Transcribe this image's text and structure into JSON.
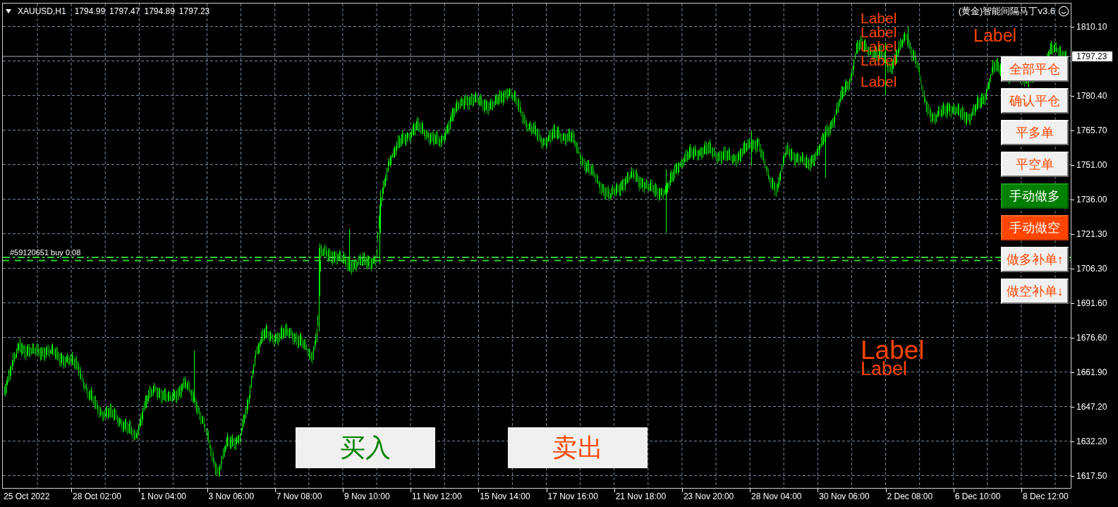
{
  "chart_header": {
    "symbol": "XAUUSD,H1",
    "ohlc": [
      "1794.99",
      "1797.47",
      "1794.89",
      "1797.23"
    ]
  },
  "expert_title": "(黄金)智能间隔马丁v3.6",
  "text_labels": [
    "Label",
    "Label",
    "Label",
    "Label",
    "Label",
    "Label",
    "Label",
    "Label"
  ],
  "order_labels": [
    "#59120651 buy 0.08"
  ],
  "panel_buttons": [
    {
      "label": "全部平仓",
      "kind": "plain"
    },
    {
      "label": "确认平仓",
      "kind": "plain"
    },
    {
      "label": "平多单",
      "kind": "plain"
    },
    {
      "label": "平空单",
      "kind": "plain"
    },
    {
      "label": "手动做多",
      "kind": "buy"
    },
    {
      "label": "手动做空",
      "kind": "sell"
    },
    {
      "label": "做多补单↑",
      "kind": "plain"
    },
    {
      "label": "做空补单↓",
      "kind": "plain"
    }
  ],
  "trade_buttons": [
    {
      "label": "买入",
      "kind": "buy"
    },
    {
      "label": "卖出",
      "kind": "sell"
    }
  ],
  "price_axis": {
    "labels": [
      "1810.10",
      "1780.40",
      "1765.70",
      "1751.00",
      "1736.00",
      "1721.30",
      "1706.30",
      "1691.60",
      "1676.60",
      "1661.90",
      "1647.20",
      "1632.20",
      "1617.50"
    ],
    "current_price": "1797.23"
  },
  "time_axis": {
    "labels": [
      "25 Oct 2022",
      "28 Oct 02:00",
      "1 Nov 04:00",
      "3 Nov 06:00",
      "7 Nov 08:00",
      "9 Nov 10:00",
      "11 Nov 12:00",
      "15 Nov 14:00",
      "17 Nov 16:00",
      "21 Nov 18:00",
      "23 Nov 20:00",
      "28 Nov 04:00",
      "30 Nov 06:00",
      "2 Dec 08:00",
      "6 Dec 10:00",
      "8 Dec 12:00"
    ]
  }
}
